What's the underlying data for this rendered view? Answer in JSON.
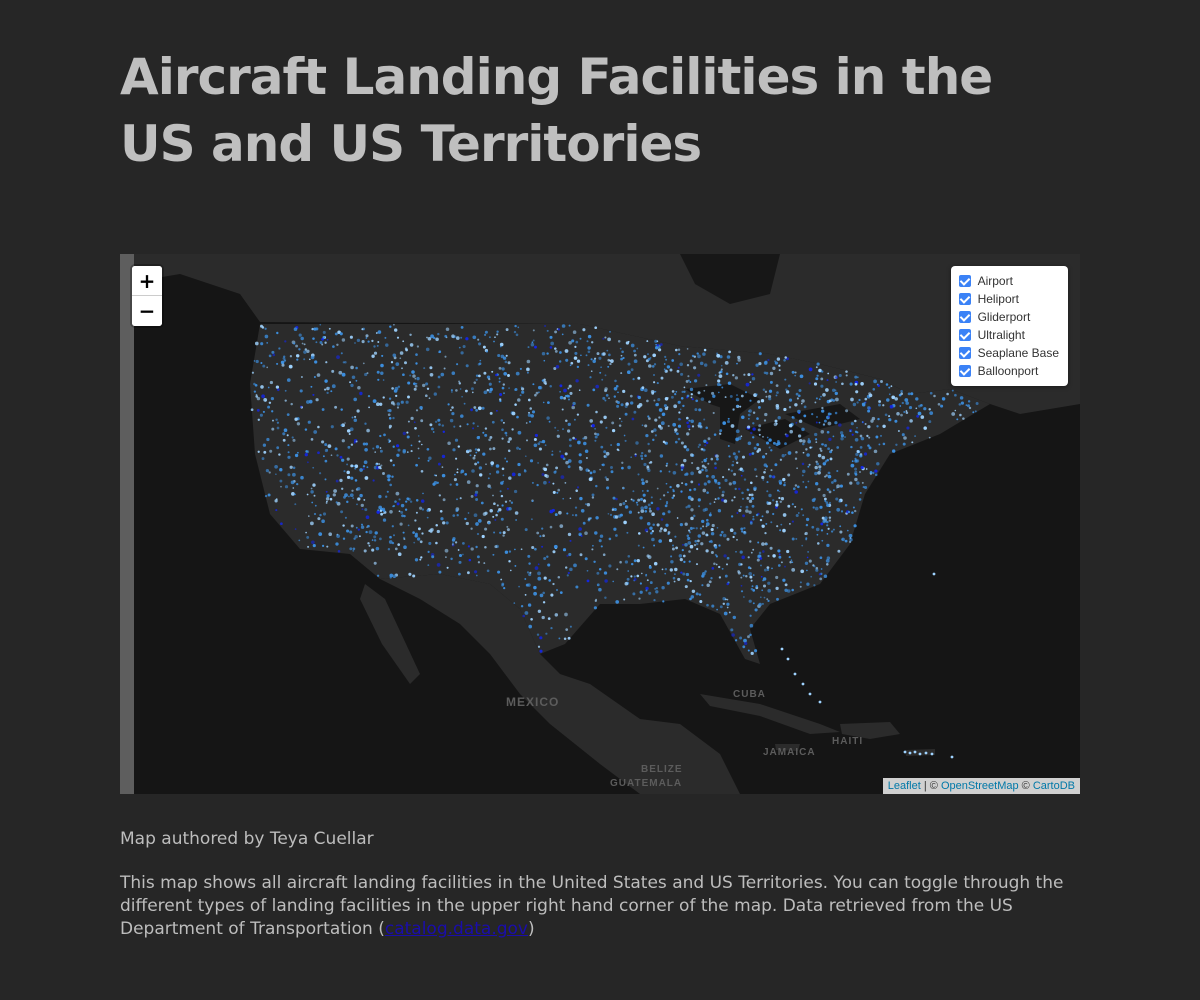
{
  "title": "Aircraft Landing Facilities in the US and US Territories",
  "map": {
    "zoom_in_label": "+",
    "zoom_out_label": "−",
    "layers": [
      {
        "label": "Airport",
        "checked": true
      },
      {
        "label": "Heliport",
        "checked": true
      },
      {
        "label": "Gliderport",
        "checked": true
      },
      {
        "label": "Ultralight",
        "checked": true
      },
      {
        "label": "Seaplane Base",
        "checked": true
      },
      {
        "label": "Balloonport",
        "checked": true
      }
    ],
    "place_labels": {
      "mexico": "MEXICO",
      "cuba": "CUBA",
      "haiti": "HAITI",
      "jamaica": "JAMAICA",
      "belize": "BELIZE",
      "guatemala": "GUATEMALA"
    },
    "attribution": {
      "leaflet": "Leaflet",
      "sep1": " | © ",
      "osm": "OpenStreetMap",
      "sep2": " © ",
      "carto": "CartoDB"
    },
    "colors": {
      "land": "#2b2b2b",
      "water": "#151515",
      "dot_light": "#9fd3ff",
      "dot_mid": "#3c8fe0",
      "dot_deep": "#1326e8"
    }
  },
  "byline": "Map authored by Teya Cuellar",
  "description": {
    "text": "This map shows all aircraft landing facilities in the United States and US Territories. You can toggle through the different types of landing facilities in the upper right hand corner of the map. Data retrieved from the US Department of Transportation (",
    "link": "catalog.data.gov",
    "after": ")"
  }
}
